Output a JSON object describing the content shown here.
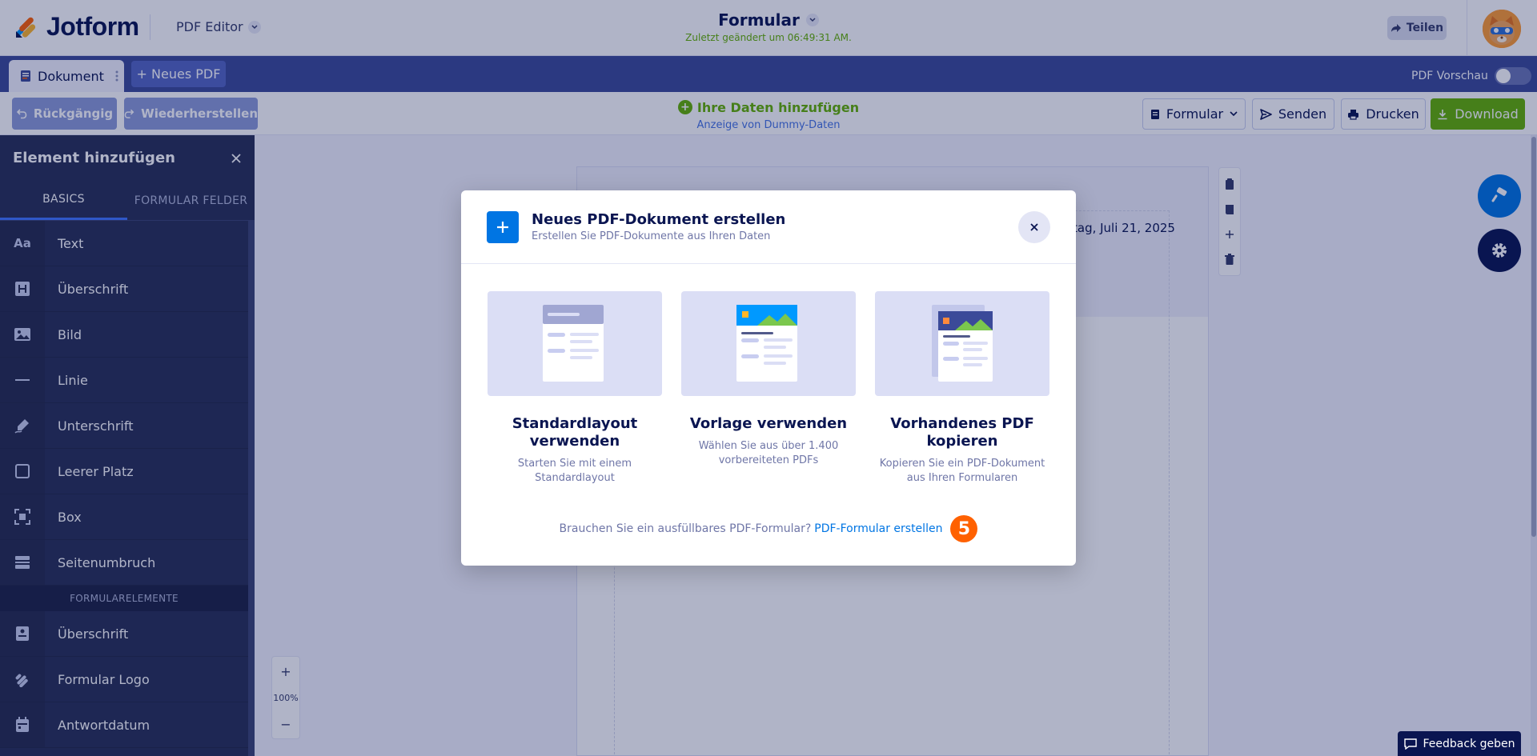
{
  "header": {
    "logo_text": "Jotform",
    "product": "PDF Editor",
    "form_title": "Formular",
    "last_changed": "Zuletzt geändert um 06:49:31 AM.",
    "share_label": "Teilen"
  },
  "tabs": {
    "document_label": "Dokument",
    "new_pdf_label": "+ Neues PDF",
    "pdf_preview_label": "PDF Vorschau"
  },
  "toolbar": {
    "undo_label": "Rückgängig",
    "redo_label": "Wiederherstellen",
    "add_data_label": "Ihre Daten hinzufügen",
    "dummy_data_label": "Anzeige von Dummy-Daten",
    "form_select_label": "Formular",
    "send_label": "Senden",
    "print_label": "Drucken",
    "download_label": "Download"
  },
  "panel": {
    "title": "Element hinzufügen",
    "tabs": [
      "BASICS",
      "FORMULAR FELDER"
    ],
    "basics": [
      {
        "icon": "text-icon",
        "label": "Text"
      },
      {
        "icon": "heading-icon",
        "label": "Überschrift"
      },
      {
        "icon": "image-icon",
        "label": "Bild"
      },
      {
        "icon": "line-icon",
        "label": "Linie"
      },
      {
        "icon": "signature-icon",
        "label": "Unterschrift"
      },
      {
        "icon": "empty-space-icon",
        "label": "Leerer Platz"
      },
      {
        "icon": "box-icon",
        "label": "Box"
      },
      {
        "icon": "page-break-icon",
        "label": "Seitenumbruch"
      }
    ],
    "section_label": "FORMULARELEMENTE",
    "form_elements": [
      {
        "icon": "form-heading-icon",
        "label": "Überschrift"
      },
      {
        "icon": "form-logo-icon",
        "label": "Formular Logo"
      },
      {
        "icon": "calendar-icon",
        "label": "Antwortdatum"
      }
    ]
  },
  "canvas": {
    "date_text": "tag, Juli 21, 2025",
    "zoom_level": "100%",
    "feedback_label": "Feedback geben"
  },
  "modal": {
    "title": "Neues PDF-Dokument erstellen",
    "subtitle": "Erstellen Sie PDF-Dokumente aus Ihren Daten",
    "cards": [
      {
        "title": "Standardlayout verwenden",
        "desc": "Starten Sie mit einem Standardlayout"
      },
      {
        "title": "Vorlage verwenden",
        "desc": "Wählen Sie aus über 1.400 vorbereiteten PDFs"
      },
      {
        "title": "Vorhandenes PDF kopieren",
        "desc": "Kopieren Sie ein PDF-Dokument aus Ihren Formularen"
      }
    ],
    "footer_text": "Brauchen Sie ein ausfüllbares PDF-Formular?",
    "footer_link": "PDF-Formular erstellen",
    "step_badge": "5"
  },
  "colors": {
    "navy": "#0a1551",
    "tab_bar": "#3b4a99",
    "panel": "#293056",
    "accent_green": "#64b200",
    "accent_blue": "#0075e3",
    "badge_orange": "#ff6100"
  }
}
